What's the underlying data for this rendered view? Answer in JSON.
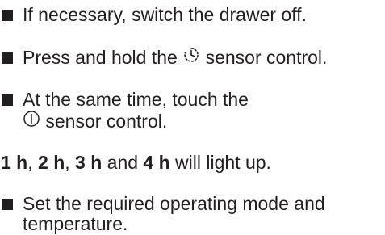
{
  "steps": [
    {
      "text": "If necessary, switch the drawer off."
    },
    {
      "text_before": "Press and hold the ",
      "icon": "timer-icon",
      "text_after": " sensor control."
    },
    {
      "line1": "At the same time, touch the",
      "icon": "power-icon",
      "line2_after": " sensor control."
    }
  ],
  "result": {
    "part1": "1 h",
    "sep1": ", ",
    "part2": "2 h",
    "sep2": ", ",
    "part3": "3 h",
    "sep3": " and ",
    "part4": "4 h",
    "tail": " will light up."
  },
  "final_step": {
    "line1": "Set the required operating mode and",
    "line2": "temperature."
  }
}
